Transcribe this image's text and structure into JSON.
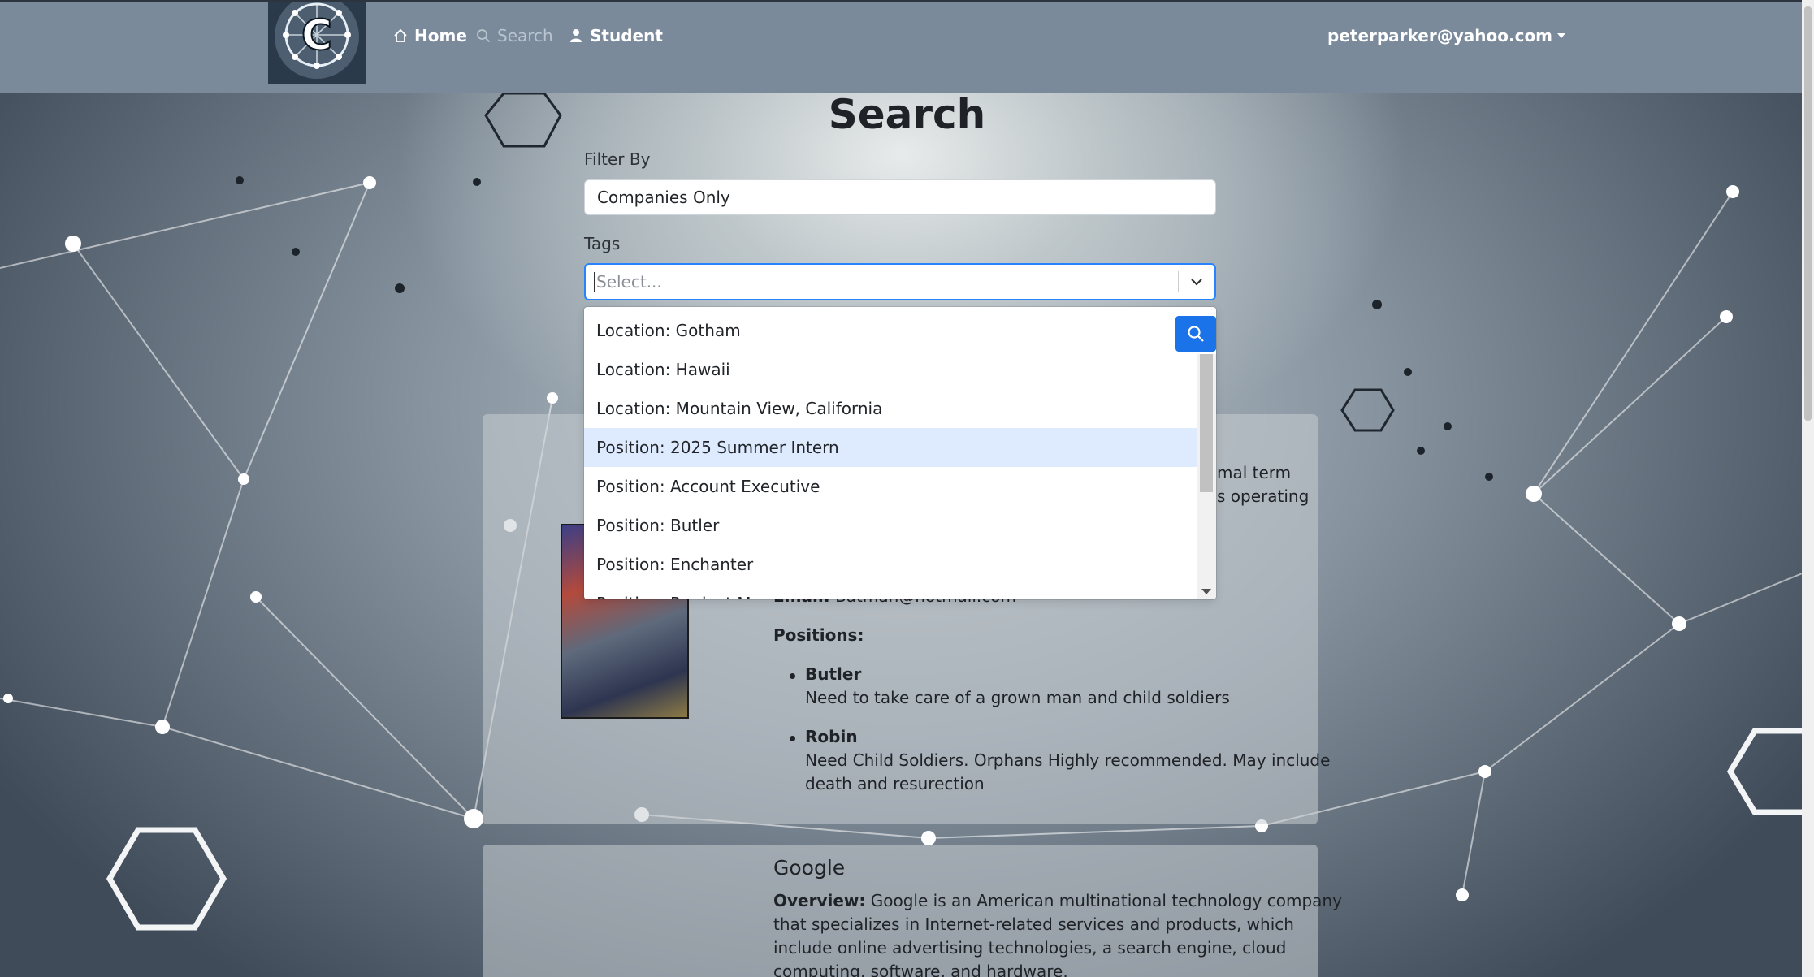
{
  "navbar": {
    "home_label": "Home",
    "search_label": "Search",
    "student_label": "Student",
    "user_email": "peterparker@yahoo.com",
    "logo_letter": "C"
  },
  "search": {
    "title": "Search",
    "filter_label": "Filter By",
    "filter_value": "Companies Only",
    "tags_label": "Tags",
    "tags_placeholder": "Select..."
  },
  "dropdown": {
    "options": [
      "Location: Gotham",
      "Location: Hawaii",
      "Location: Mountain View, California",
      "Position: 2025 Summer Intern",
      "Position: Account Executive",
      "Position: Butler",
      "Position: Enchanter",
      "Position: Product M"
    ],
    "focused_index": 3
  },
  "card1": {
    "overview_tail_1": "mal term",
    "overview_tail_2": "s operating",
    "email_label": "Email:",
    "email_value": "Batman@hotmail.com",
    "positions_label": "Positions:",
    "positions": [
      {
        "title": "Butler",
        "description": "Need to take care of a grown man and child soldiers"
      },
      {
        "title": "Robin",
        "description_line1": "Need Child Soldiers. Orphans Highly recommended. May include",
        "description_line2": "death and resurection"
      }
    ]
  },
  "card2": {
    "name": "Google",
    "overview_label": "Overview:",
    "overview_line1": "Google is an American multinational technology company",
    "overview_line2": "that specializes in Internet-related services and products, which",
    "overview_line3": "include online advertising technologies, a search engine, cloud",
    "overview_line4": "computing, software, and hardware."
  },
  "colors": {
    "navbar": "#7a8a9b",
    "accent_blue": "#1a73e8",
    "focus_border": "#2684ff",
    "option_focus": "#deebff"
  }
}
